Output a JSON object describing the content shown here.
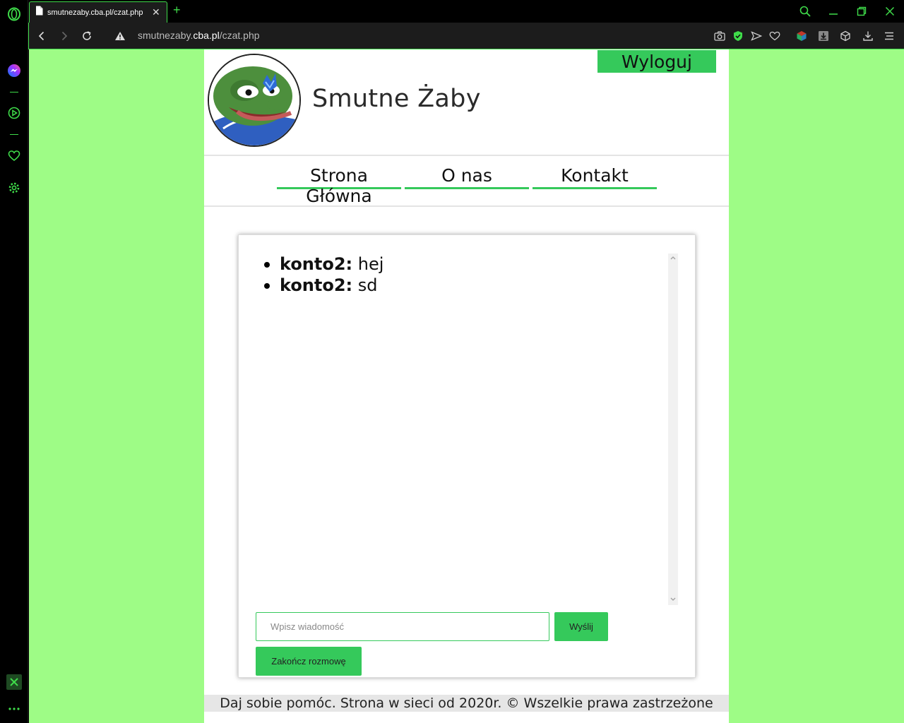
{
  "browser": {
    "tab_title": "smutnezaby.cba.pl/czat.php",
    "new_tab": "+",
    "tab_close": "✕",
    "url_domain": "smutnezaby.",
    "url_domain_bold": "cba.pl",
    "url_path": "/czat.php",
    "accent_color": "#3fdc4a"
  },
  "header": {
    "site_title": "Smutne Żaby",
    "logout_label": "Wyloguj"
  },
  "nav": {
    "items": [
      {
        "label": "Strona Główna"
      },
      {
        "label": "O nas"
      },
      {
        "label": "Kontakt"
      }
    ]
  },
  "chat": {
    "messages": [
      {
        "user": "konto2:",
        "text": " hej"
      },
      {
        "user": "konto2:",
        "text": " sd"
      }
    ],
    "input_placeholder": "Wpisz wiadomość",
    "send_label": "Wyślij",
    "end_label": "Zakończ rozmowę"
  },
  "footer": {
    "text": "Daj sobie pomóc. Strona w sieci od 2020r. © Wszelkie prawa zastrzeżone"
  },
  "colors": {
    "page_bg": "#9efc86",
    "button_green": "#35c95b"
  }
}
